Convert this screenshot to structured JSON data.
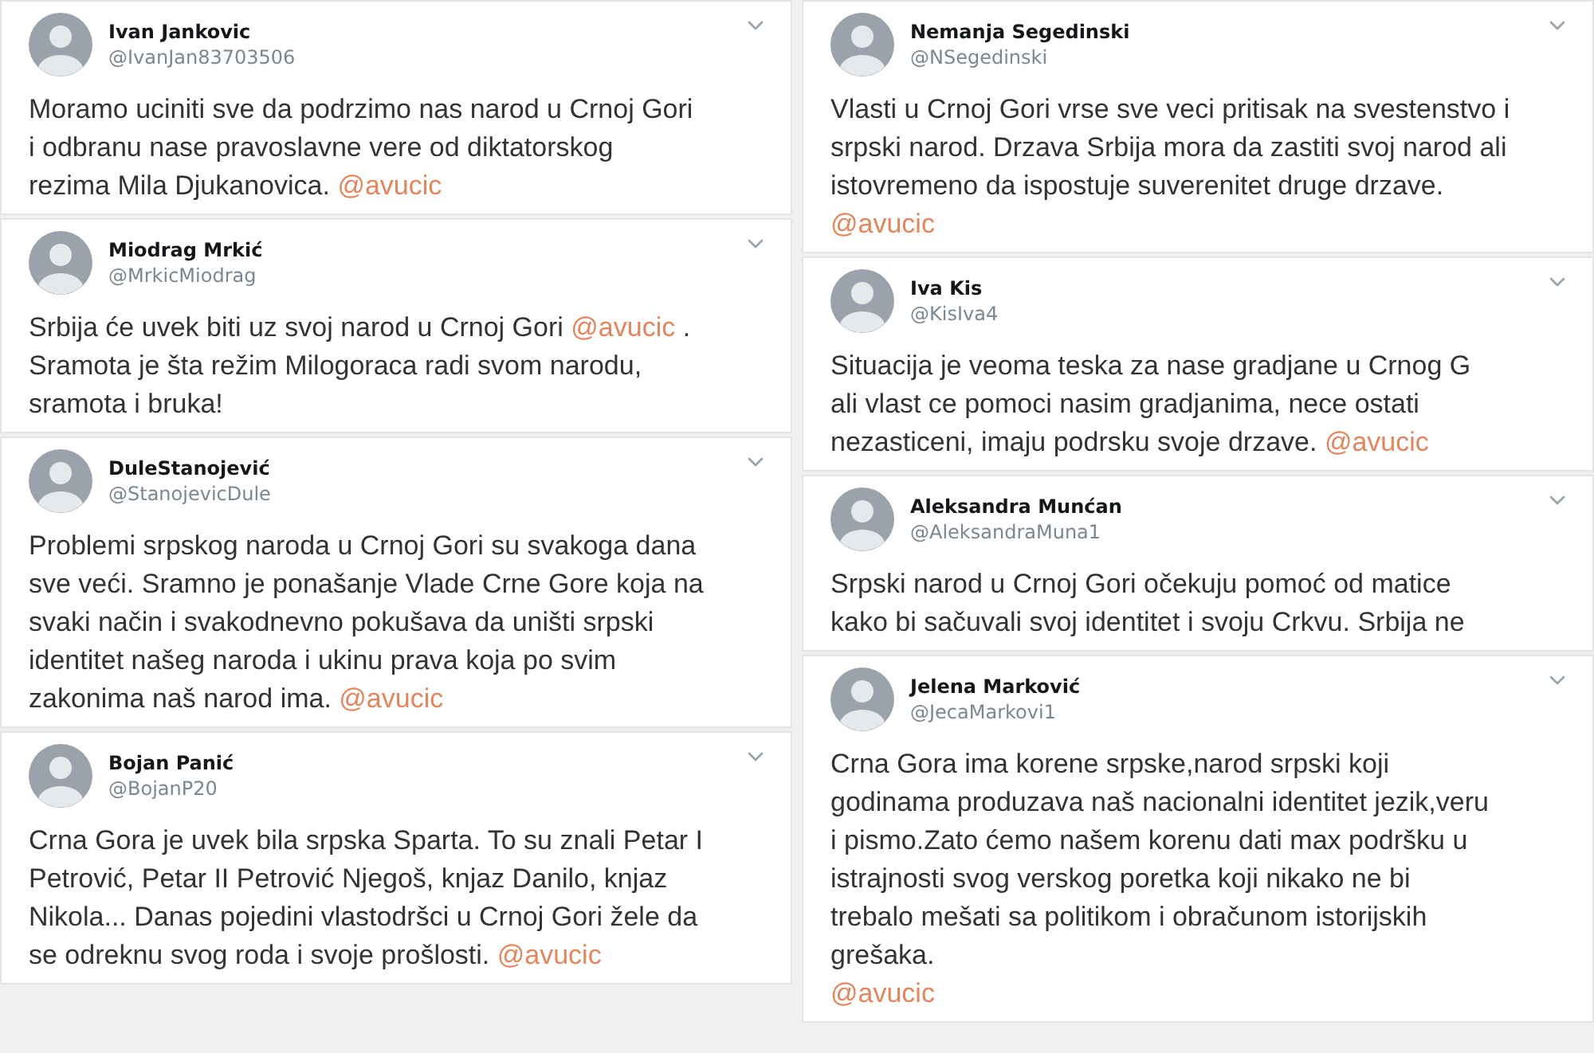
{
  "columns": [
    {
      "tweets": [
        {
          "name": "Ivan Jankovic",
          "handle": "@IvanJan83703506",
          "parts": [
            {
              "kind": "text",
              "text": "Moramo uciniti sve da podrzimo nas narod u Crnoj Gori\ni odbranu nase pravoslavne vere od diktatorskog\nrezima Mila Djukanovica. "
            },
            {
              "kind": "mention",
              "text": "@avucic"
            }
          ]
        },
        {
          "name": "Miodrag Mrkić",
          "handle": "@MrkicMiodrag",
          "parts": [
            {
              "kind": "text",
              "text": "Srbija će uvek biti uz svoj narod u Crnoj Gori "
            },
            {
              "kind": "mention",
              "text": "@avucic"
            },
            {
              "kind": "text",
              "text": " .\nSramota je šta režim Milogoraca radi svom narodu,\nsramota i bruka!"
            }
          ]
        },
        {
          "name": "DuleStanojević",
          "handle": "@StanojevicDule",
          "parts": [
            {
              "kind": "text",
              "text": "Problemi srpskog naroda u Crnoj Gori su svakoga dana\nsve veći. Sramno je ponašanje Vlade Crne Gore koja na\nsvaki način i svakodnevno pokušava da uništi srpski\nidentitet našeg naroda i ukinu prava koja po svim\nzakonima naš narod ima. "
            },
            {
              "kind": "mention",
              "text": "@avucic"
            }
          ]
        },
        {
          "name": "Bojan Panić",
          "handle": "@BojanP20",
          "parts": [
            {
              "kind": "text",
              "text": "Crna Gora je uvek bila srpska Sparta. To su znali Petar I\nPetrović, Petar II Petrović Njegoš, knjaz Danilo, knjaz\nNikola... Danas pojedini vlastodršci u Crnoj Gori žele da\nse odreknu svog roda i svoje prošlosti. "
            },
            {
              "kind": "mention",
              "text": "@avucic"
            }
          ]
        }
      ]
    },
    {
      "tweets": [
        {
          "name": "Nemanja Segedinski",
          "handle": "@NSegedinski",
          "parts": [
            {
              "kind": "text",
              "text": "Vlasti u Crnoj Gori vrse sve veci pritisak na svestenstvo i\nsrpski narod. Drzava Srbija mora da zastiti svoj narod ali\nistovremeno da ispostuje suverenitet druge drzave.\n"
            },
            {
              "kind": "mention",
              "text": "@avucic"
            }
          ]
        },
        {
          "name": "Iva Kis",
          "handle": "@KisIva4",
          "parts": [
            {
              "kind": "text",
              "text": "Situacija je veoma teska za nase gradjane u Crnog G\nali vlast ce pomoci nasim gradjanima, nece ostati\nnezasticeni, imaju podrsku svoje drzave. "
            },
            {
              "kind": "mention",
              "text": "@avucic"
            }
          ]
        },
        {
          "name": "Aleksandra Munćan",
          "handle": "@AleksandraMuna1",
          "parts": [
            {
              "kind": "text",
              "text": "Srpski narod u Crnoj Gori očekuju pomoć od matice\nkako bi sačuvali svoj identitet i svoju Crkvu. Srbija ne"
            }
          ]
        },
        {
          "name": "Jelena Marković",
          "handle": "@JecaMarkovi1",
          "parts": [
            {
              "kind": "text",
              "text": "Crna Gora ima korene srpske,narod srpski koji\ngodinama produzava naš nacionalni identitet jezik,veru\ni pismo.Zato ćemo našem korenu dati max podršku u\nistrajnosti svog verskog poretka koji nikako ne bi\ntrebalo mešati sa politikom i obračunom istorijskih\ngrešaka.\n"
            },
            {
              "kind": "mention",
              "text": "@avucic"
            }
          ]
        }
      ]
    }
  ]
}
